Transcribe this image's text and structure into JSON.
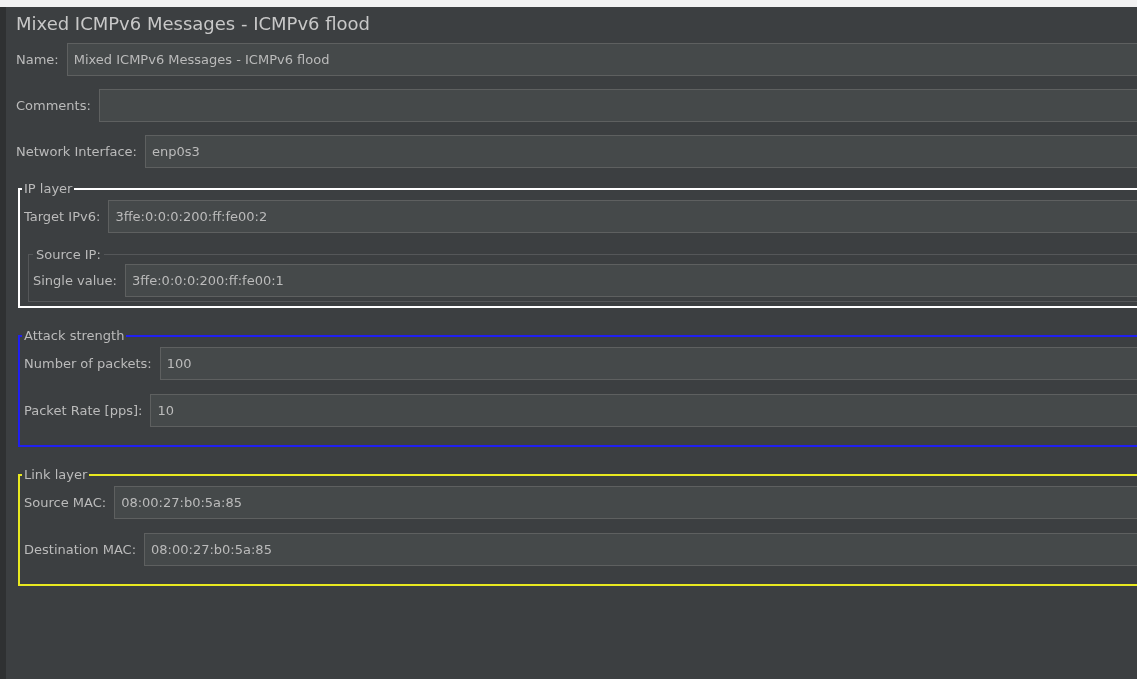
{
  "window": {
    "title": "Mixed ICMPv6 Messages - ICMPv6 flood"
  },
  "fields": [
    {
      "label": "Name:",
      "value": "Mixed ICMPv6 Messages - ICMPv6 flood"
    },
    {
      "label": "Comments:"
    },
    {
      "label": "Network Interface:",
      "value": "enp0s3"
    }
  ],
  "groups": [
    {
      "title": "IP layer",
      "color": "#ffffff",
      "fields": [
        {
          "label": "Target IPv6:",
          "value": "3ffe:0:0:0:200:ff:fe00:2"
        }
      ],
      "subgroups": [
        {
          "title": "Source IP:",
          "fields": [
            {
              "label": "Single value:",
              "value": "3ffe:0:0:0:200:ff:fe00:1"
            }
          ]
        }
      ]
    },
    {
      "title": "Attack strength",
      "color": "#2020f0",
      "fields": [
        {
          "label": "Number of packets:",
          "value": "100"
        },
        {
          "label": "Packet Rate [pps]:",
          "value": "10"
        }
      ]
    },
    {
      "title": "Link layer",
      "color": "#e8e820",
      "fields": [
        {
          "label": "Source MAC:",
          "value": "08:00:27:b0:5a:85"
        },
        {
          "label": "Destination MAC:",
          "value": "08:00:27:b0:5a:85"
        }
      ]
    }
  ]
}
